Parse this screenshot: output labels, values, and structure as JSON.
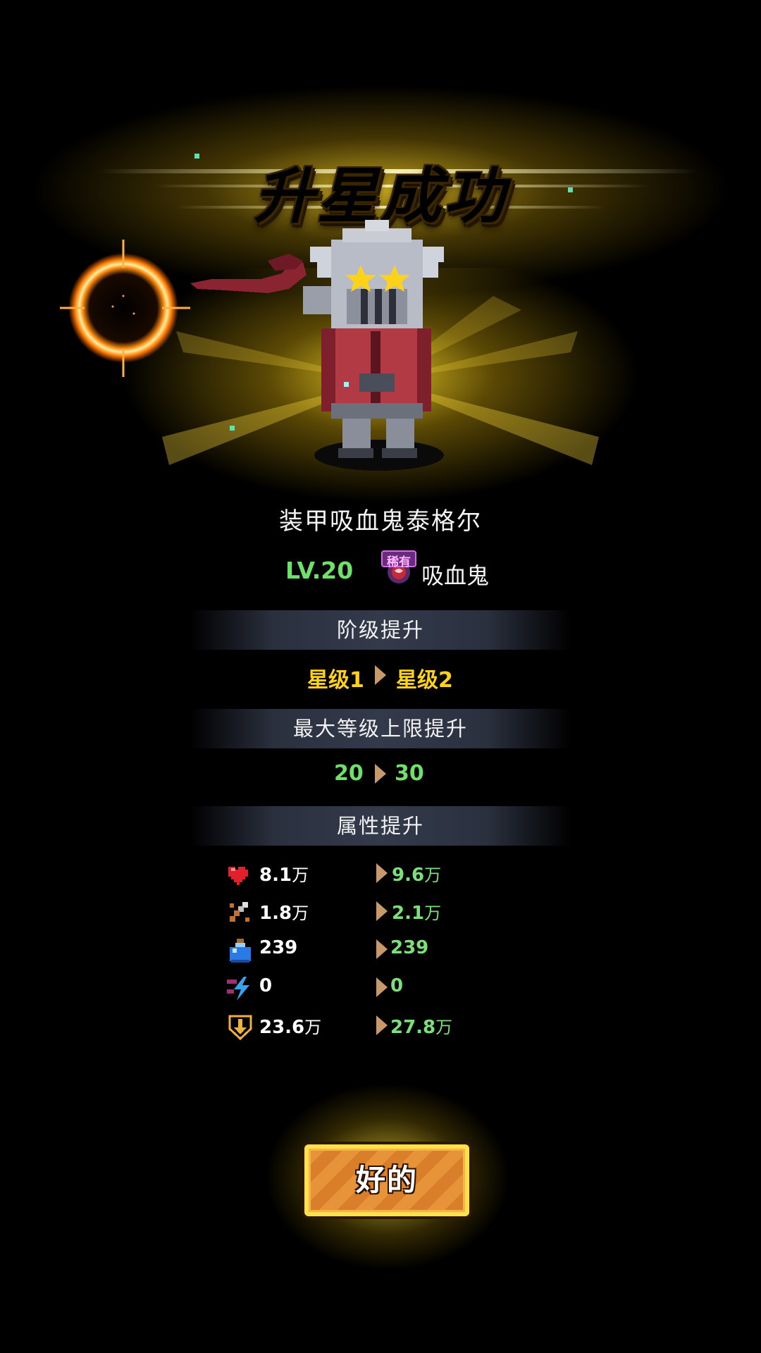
{
  "banner": {
    "title": "升星成功"
  },
  "hero": {
    "name": "装甲吸血鬼泰格尔",
    "level": "LV.20",
    "rarity_badge": "稀有",
    "class_name": "吸血鬼"
  },
  "sections": {
    "rank": {
      "header": "阶级提升",
      "from": "星级1",
      "to": "星级2"
    },
    "max_level": {
      "header": "最大等级上限提升",
      "from": "20",
      "to": "30"
    },
    "attributes": {
      "header": "属性提升",
      "rows": [
        {
          "icon": "heart-icon",
          "old": "8.1",
          "old_unit": "万",
          "new": "9.6",
          "new_unit": "万"
        },
        {
          "icon": "swords-icon",
          "old": "1.8",
          "old_unit": "万",
          "new": "2.1",
          "new_unit": "万"
        },
        {
          "icon": "potion-icon",
          "old": "239",
          "old_unit": "",
          "new": "239",
          "new_unit": ""
        },
        {
          "icon": "speed-icon",
          "old": "0",
          "old_unit": "",
          "new": "0",
          "new_unit": ""
        },
        {
          "icon": "power-shield-icon",
          "old": "23.6",
          "old_unit": "万",
          "new": "27.8",
          "new_unit": "万"
        }
      ]
    }
  },
  "confirm_button": {
    "label": "好的"
  },
  "colors": {
    "gold": "#ffd21a",
    "green": "#6fe06a",
    "arrow": "#c89a6a",
    "band": "#2a303e",
    "button_orange": "#e6933a",
    "button_border": "#ffe14a"
  }
}
